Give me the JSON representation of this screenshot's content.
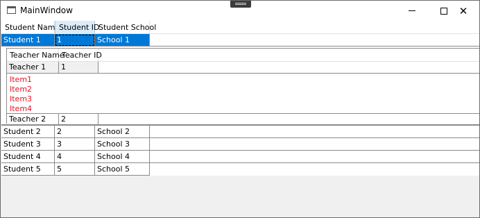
{
  "window": {
    "title": "MainWindow"
  },
  "columns": [
    "Student Name",
    "Student ID",
    "Student School"
  ],
  "students": [
    {
      "name": "Student 1",
      "id": "1",
      "school": "School 1"
    },
    {
      "name": "Student 2",
      "id": "2",
      "school": "School 2"
    },
    {
      "name": "Student 3",
      "id": "3",
      "school": "School 3"
    },
    {
      "name": "Student 4",
      "id": "4",
      "school": "School 4"
    },
    {
      "name": "Student 5",
      "id": "5",
      "school": "School 5"
    }
  ],
  "details": {
    "columns": [
      "Teacher Name",
      "Teacher ID"
    ],
    "teachers": [
      {
        "name": "Teacher 1",
        "id": "1",
        "items": [
          "Item1",
          "Item2",
          "Item3",
          "Item4"
        ]
      },
      {
        "name": "Teacher 2",
        "id": "2"
      }
    ]
  },
  "colors": {
    "selection": "#0078d7",
    "item_text": "#e81123",
    "header_active": "#dbecf9"
  }
}
